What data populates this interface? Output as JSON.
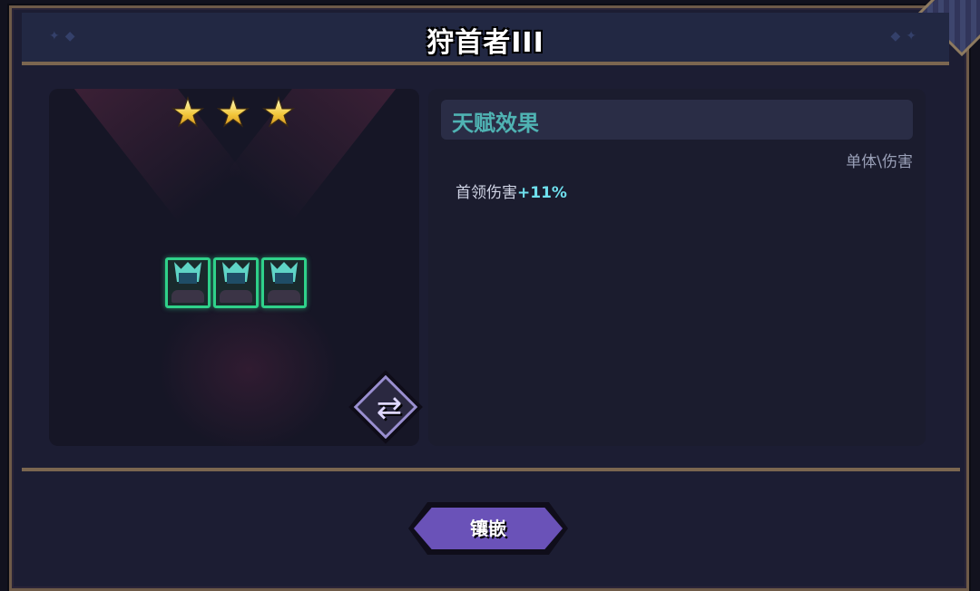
{
  "header": {
    "title": "狩首者III"
  },
  "stars": {
    "count": 3,
    "max": 3
  },
  "units": [
    {
      "name": "rune-unit-1"
    },
    {
      "name": "rune-unit-2"
    },
    {
      "name": "rune-unit-3"
    }
  ],
  "talent": {
    "section_title": "天赋效果",
    "type": "单体\\伤害",
    "effect_label": "首领伤害",
    "effect_value": "+11%"
  },
  "actions": {
    "embed_label": "镶嵌"
  },
  "colors": {
    "accent": "#6a52b8",
    "talent_title": "#4fb3b3",
    "effect_value": "#6fe0ee",
    "unit_border": "#2fd18a"
  }
}
